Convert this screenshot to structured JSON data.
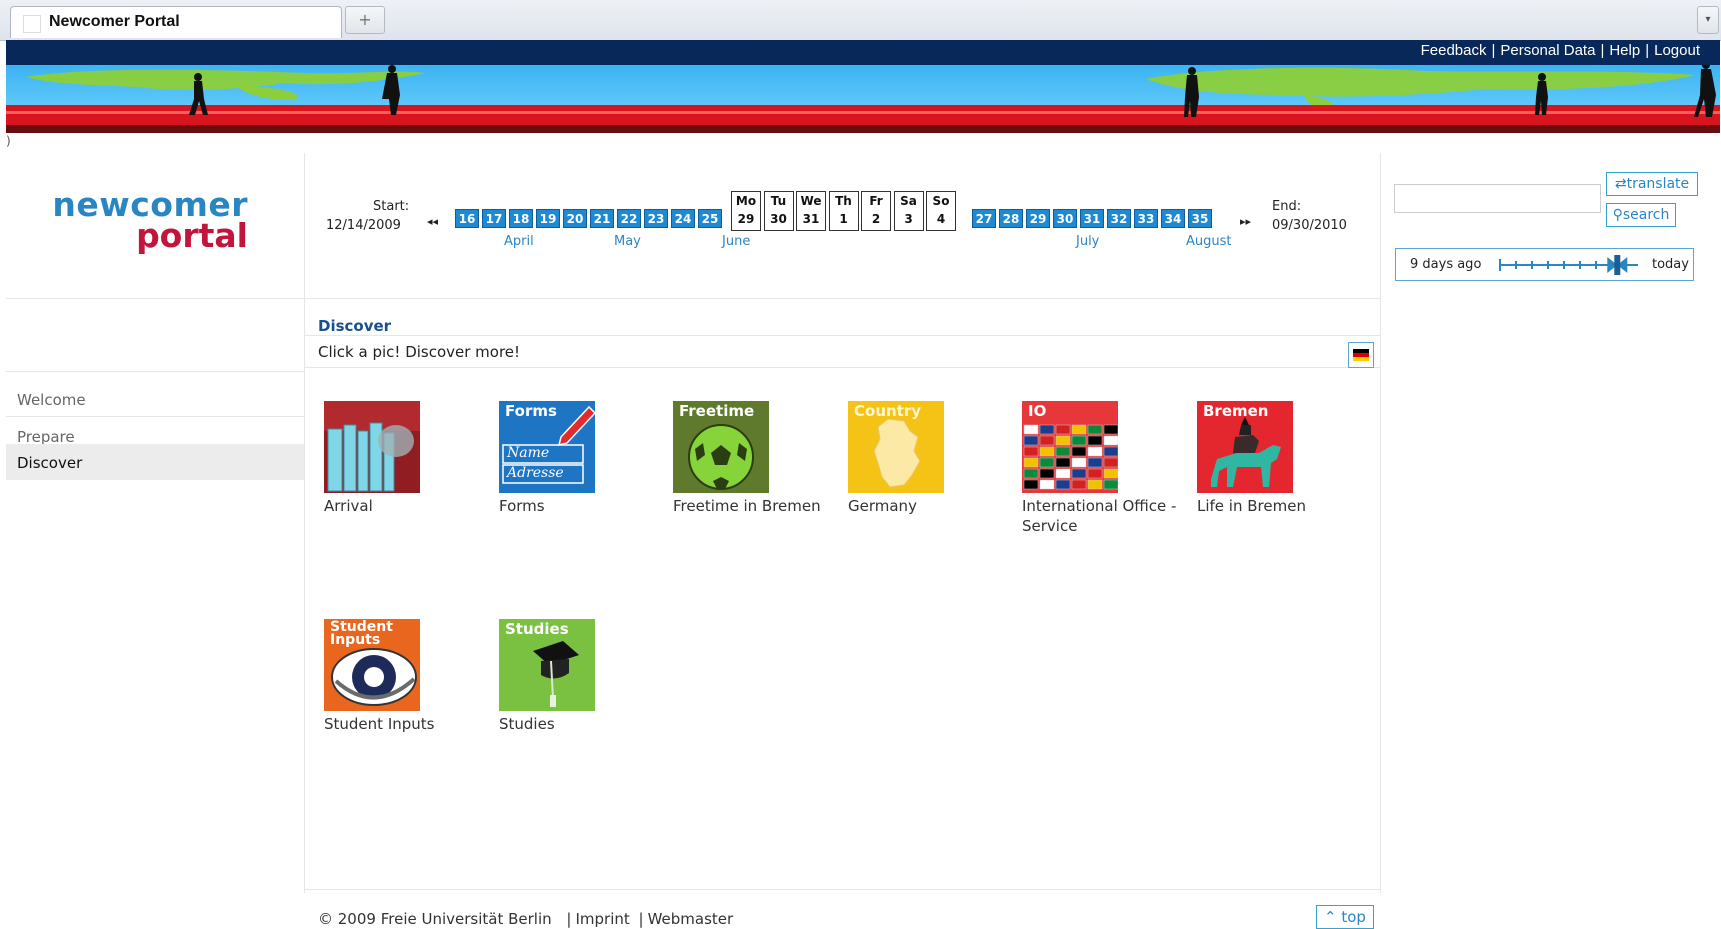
{
  "browser": {
    "tab_title": "Newcomer Portal",
    "new_tab_glyph": "+",
    "dropdown_glyph": "▾"
  },
  "topnav": {
    "links": [
      "Feedback",
      "Personal Data",
      "Help",
      "Logout"
    ],
    "separator": "|"
  },
  "logo": {
    "line1": "newcomer",
    "line2": "portal"
  },
  "timeline": {
    "start_label": "Start:",
    "start_date": "12/14/2009",
    "end_label": "End:",
    "end_date": "09/30/2010",
    "prev_glyph": "◂◂",
    "next_glyph": "▸▸",
    "weeks_before": [
      "16",
      "17",
      "18",
      "19",
      "20",
      "21",
      "22",
      "23",
      "24",
      "25"
    ],
    "days": [
      {
        "name": "Mo",
        "num": "29"
      },
      {
        "name": "Tu",
        "num": "30"
      },
      {
        "name": "We",
        "num": "31"
      },
      {
        "name": "Th",
        "num": "1"
      },
      {
        "name": "Fr",
        "num": "2"
      },
      {
        "name": "Sa",
        "num": "3"
      },
      {
        "name": "So",
        "num": "4"
      }
    ],
    "weeks_after": [
      "27",
      "28",
      "29",
      "30",
      "31",
      "32",
      "33",
      "34",
      "35"
    ],
    "months": [
      "April",
      "May",
      "June",
      "July",
      "August"
    ]
  },
  "right_panel": {
    "translate_label": "translate",
    "search_label": "search",
    "slider_left": "9 days ago",
    "slider_right": "today",
    "slider_position": 0.85
  },
  "leftnav": {
    "items": [
      {
        "label": "Welcome",
        "active": false
      },
      {
        "label": "Prepare",
        "active": false
      },
      {
        "label": "Discover",
        "active": true
      }
    ]
  },
  "main": {
    "title": "Discover",
    "subtitle": "Click a pic! Discover more!",
    "tiles": [
      {
        "label": "Arrival",
        "header": "",
        "color": "#8f1d22"
      },
      {
        "label": "Forms",
        "header": "Forms",
        "color": "#1d75c4"
      },
      {
        "label": "Freetime in Bremen",
        "header": "Freetime",
        "color": "#5f7a2c"
      },
      {
        "label": "Germany",
        "header": "Country",
        "color": "#f5c316"
      },
      {
        "label": "International Office - Service",
        "header": "IO",
        "color": "#e8373a"
      },
      {
        "label": "Life in Bremen",
        "header": "Bremen",
        "color": "#e4272f"
      },
      {
        "label": "Student Inputs",
        "header": "Student Inputs",
        "color": "#e8661e"
      },
      {
        "label": "Studies",
        "header": "Studies",
        "color": "#7ac142"
      }
    ]
  },
  "forms_tile_text": [
    "Name",
    "Adresse"
  ],
  "footer": {
    "copyright": "© 2009  Freie Universität Berlin",
    "links": [
      "Imprint",
      "Webmaster"
    ],
    "separator": "|",
    "top_label": "top"
  },
  "misc": {
    "left_paren": ")"
  }
}
